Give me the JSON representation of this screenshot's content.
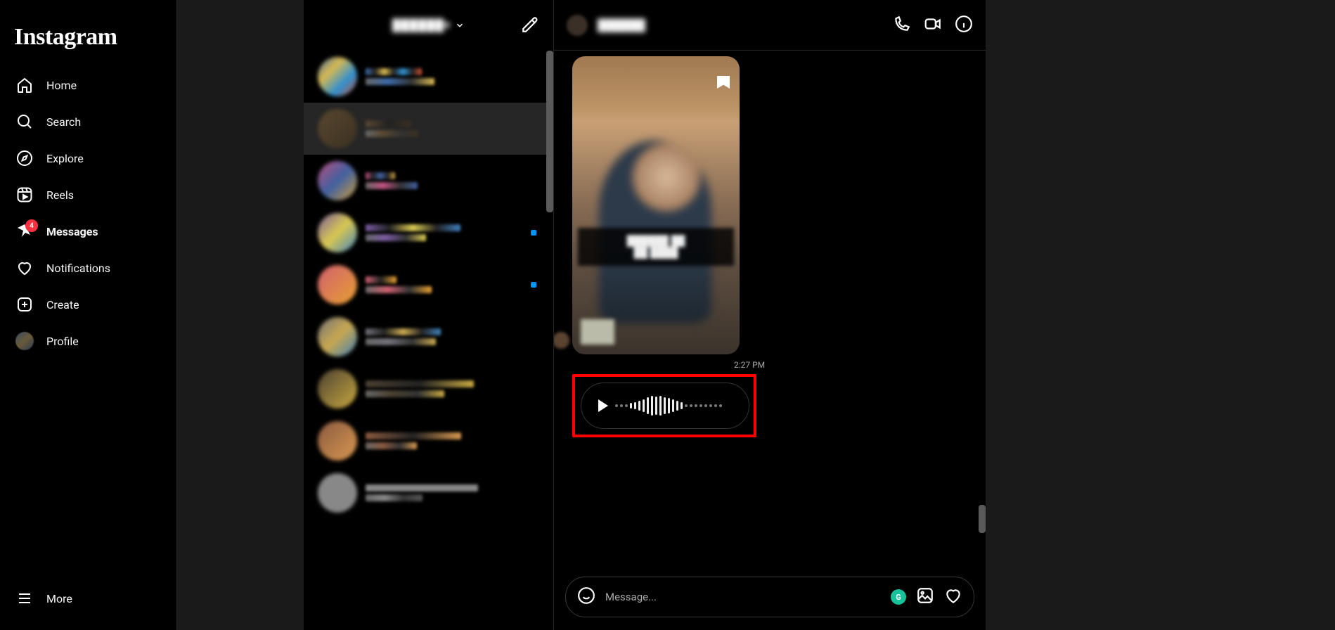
{
  "brand": "Instagram",
  "nav": {
    "home": "Home",
    "search": "Search",
    "explore": "Explore",
    "reels": "Reels",
    "messages": "Messages",
    "messages_badge": "4",
    "notifications": "Notifications",
    "create": "Create",
    "profile": "Profile",
    "more": "More"
  },
  "dm": {
    "account_username": "██████▾",
    "conversations": [
      {
        "name": "████ ████",
        "preview": "██████ ██",
        "unread": false
      },
      {
        "name": "█ █",
        "preview": "███████",
        "unread": false,
        "selected": true
      },
      {
        "name": "██ ██",
        "preview": "██████ █",
        "unread": false
      },
      {
        "name": "██████ ████",
        "preview": "███ ████",
        "unread": true
      },
      {
        "name": "████",
        "preview": "██",
        "unread": true
      },
      {
        "name": "████ ████",
        "preview": "██████ ██ █",
        "unread": false
      },
      {
        "name": "██",
        "preview": "███ ██",
        "unread": false
      },
      {
        "name": "████ ██",
        "preview": "",
        "unread": false
      },
      {
        "name": "█",
        "preview": "",
        "unread": false
      }
    ]
  },
  "chat": {
    "header_name": "██████",
    "post_caption_line1": "██████ ██",
    "post_caption_line2": "██ ████",
    "timestamp": "2:27 PM",
    "composer_placeholder": "Message...",
    "grammarly_glyph": "G"
  },
  "voice": {
    "waveform_heights": [
      3,
      3,
      3,
      8,
      10,
      14,
      18,
      24,
      28,
      26,
      28,
      24,
      22,
      18,
      14,
      10,
      3,
      3,
      3,
      3,
      3,
      3,
      3,
      3
    ],
    "played_until_index": 16
  }
}
